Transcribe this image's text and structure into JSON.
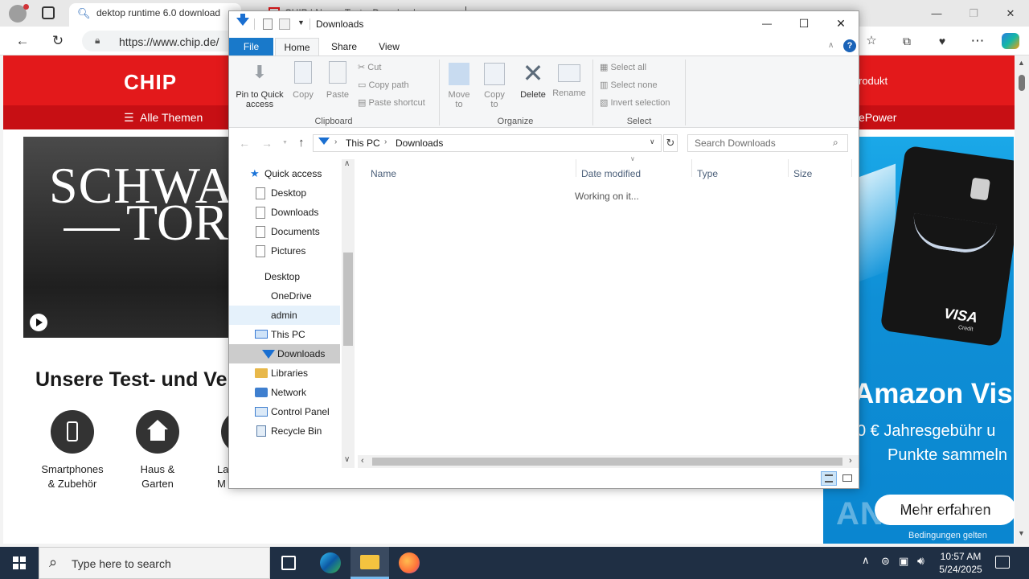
{
  "browser": {
    "tabs": [
      {
        "title": "dektop runtime 6.0 download",
        "active": true
      },
      {
        "title": "CHIP | News, Tests, Downloads",
        "active": false
      }
    ],
    "url": "https://www.chip.de/",
    "window_controls": {
      "minimize": "—",
      "maximize": "❐",
      "close": "✕"
    }
  },
  "webpage": {
    "logo": "CHIP",
    "menu_label": "Alle Themen",
    "nav_right_1": "rodukt",
    "nav_right_2": "ePower",
    "hero_text_line1": "SCHWA",
    "hero_text_line2": "TOR",
    "section_title": "Unsere Test- und Ver",
    "categories": [
      {
        "label_line1": "Smartphones",
        "label_line2": "& Zubehör",
        "icon": "smartphone-icon"
      },
      {
        "label_line1": "Haus &",
        "label_line2": "Garten",
        "icon": "house-icon"
      },
      {
        "label_line1": "La",
        "label_line2": "M",
        "icon": "circle-icon"
      }
    ],
    "ad": {
      "headline": "Amazon Vis",
      "subline1": "0 € Jahresgebühr u",
      "subline2": "Punkte sammeln",
      "cta": "Mehr erfahren",
      "footnote": "Bedingungen gelten",
      "card_brand": "VISA",
      "card_sub": "Credit"
    },
    "watermark": "ANY RUN"
  },
  "explorer": {
    "title": "Downloads",
    "window_controls": {
      "minimize": "—",
      "maximize": "☐",
      "close": "✕"
    },
    "ribbon_tabs": [
      "File",
      "Home",
      "Share",
      "View"
    ],
    "clipboard": {
      "pin_line1": "Pin to Quick",
      "pin_line2": "access",
      "copy": "Copy",
      "paste": "Paste",
      "cut": "Cut",
      "copy_path": "Copy path",
      "paste_shortcut": "Paste shortcut",
      "group_label": "Clipboard"
    },
    "organize": {
      "move_line1": "Move",
      "move_line2": "to",
      "copy_line1": "Copy",
      "copy_line2": "to",
      "delete": "Delete",
      "rename": "Rename",
      "group_label": "Organize"
    },
    "select": {
      "select_all": "Select all",
      "select_none": "Select none",
      "invert": "Invert selection",
      "group_label": "Select"
    },
    "address": {
      "crumb1": "This PC",
      "crumb2": "Downloads"
    },
    "search_placeholder": "Search Downloads",
    "nav_pane": [
      {
        "label": "Quick access",
        "icon": "star-icon"
      },
      {
        "label": "Desktop",
        "icon": "page-icon"
      },
      {
        "label": "Downloads",
        "icon": "page-icon"
      },
      {
        "label": "Documents",
        "icon": "page-icon"
      },
      {
        "label": "Pictures",
        "icon": "page-icon"
      },
      {
        "label": "Desktop",
        "icon": ""
      },
      {
        "label": "OneDrive",
        "icon": ""
      },
      {
        "label": "admin",
        "icon": ""
      },
      {
        "label": "This PC",
        "icon": "monitor-icon"
      },
      {
        "label": "Downloads",
        "icon": "download-arrow-icon"
      },
      {
        "label": "Libraries",
        "icon": "folder-icon"
      },
      {
        "label": "Network",
        "icon": "network-icon"
      },
      {
        "label": "Control Panel",
        "icon": "control-panel-icon"
      },
      {
        "label": "Recycle Bin",
        "icon": "recycle-bin-icon"
      }
    ],
    "columns": [
      "Name",
      "Date modified",
      "Type",
      "Size"
    ],
    "status": "Working on it..."
  },
  "taskbar": {
    "search_placeholder": "Type here to search",
    "time": "10:57 AM",
    "date": "5/24/2025"
  }
}
